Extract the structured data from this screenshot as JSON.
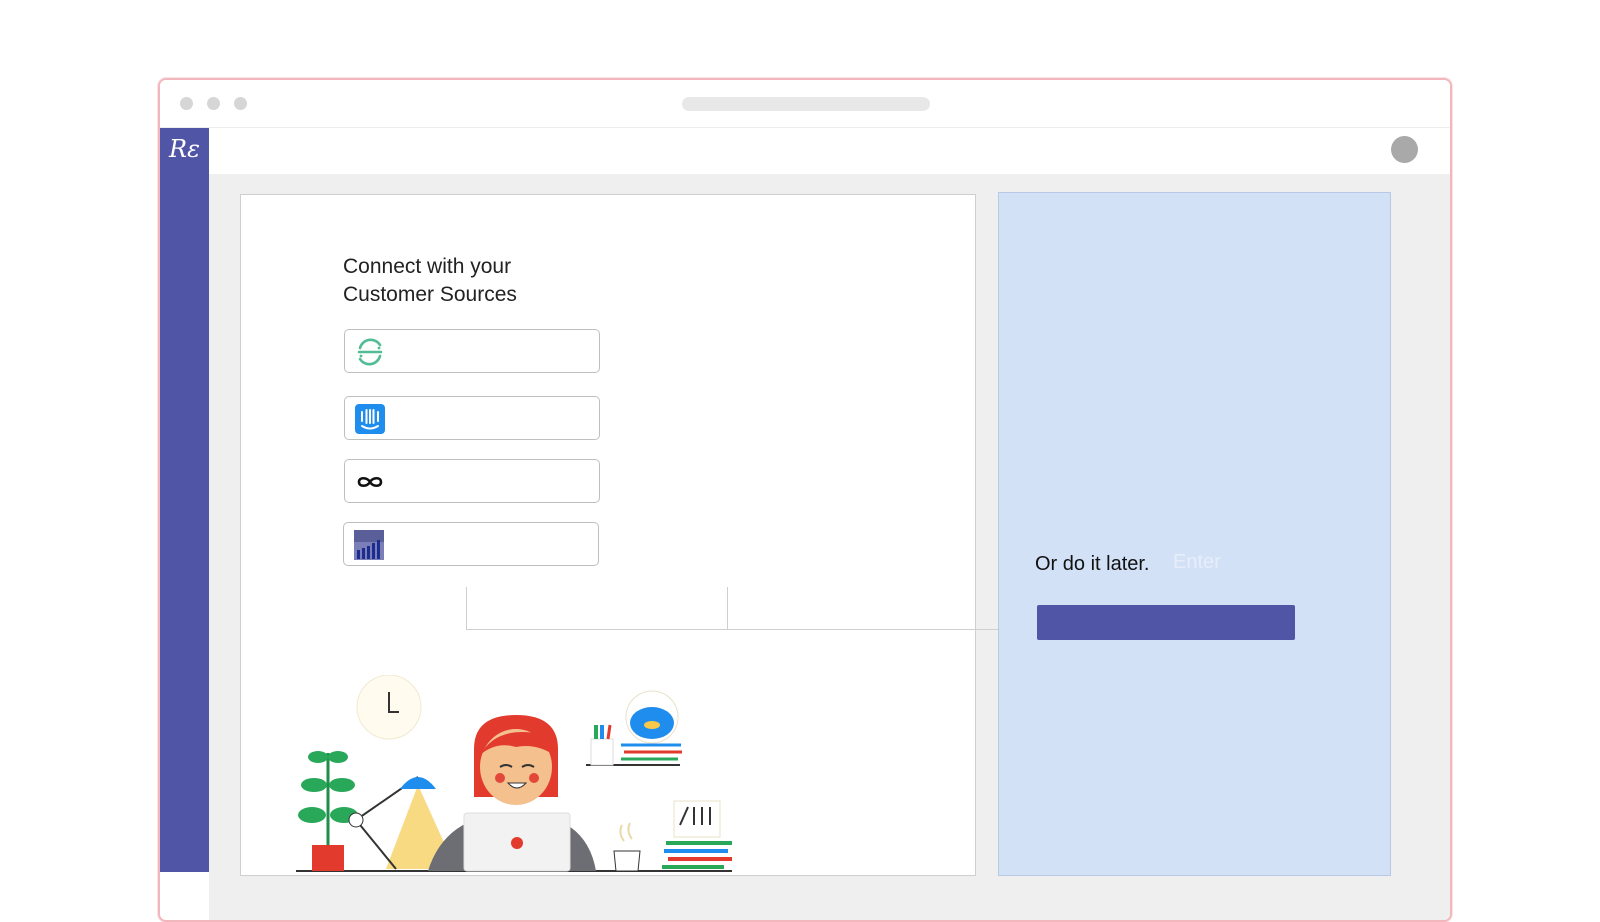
{
  "app": {
    "logo_text": "Rε"
  },
  "connect": {
    "heading_line1": "Connect with your",
    "heading_line2": "Customer Sources"
  },
  "sources": [
    {
      "icon": "segment-icon",
      "color": "#52bd94"
    },
    {
      "icon": "intercom-icon",
      "color": "#1f8ded"
    },
    {
      "icon": "infinity-icon",
      "color": "#111111"
    },
    {
      "icon": "bar-chart-icon",
      "color": "#2b3a8f"
    }
  ],
  "later": {
    "text": "Or do it later.",
    "enter_hint": "Enter"
  },
  "colors": {
    "sidebar": "#5155a6",
    "panel": "#d3e1f7",
    "accent": "#5155a6"
  }
}
